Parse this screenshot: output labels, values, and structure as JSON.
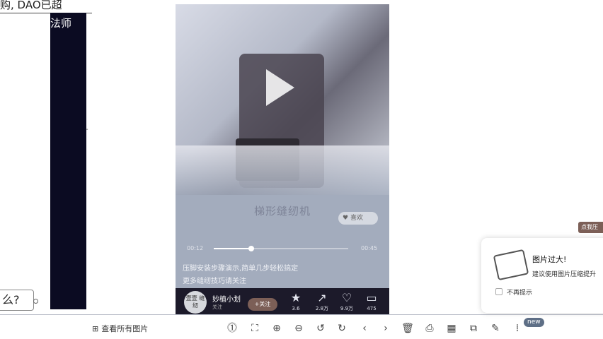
{
  "background_doc": {
    "top_text": "购, DAO已超",
    "panel_text": "法师",
    "left_bubble": "么?"
  },
  "photo": {
    "caption": "梯形缝纫机",
    "like_label": "喜欢",
    "progress_fraction": 0.28,
    "time_elapsed": "00:12",
    "time_total": "00:45",
    "description_line_1": "压脚安装步骤演示,简单几步轻松搞定",
    "description_line_2": "更多缝纫技巧请关注",
    "creator": {
      "avatar_text": "壹壹\n缝纫",
      "name": "妙植小划",
      "sub": "关注",
      "follow_label": "+关注"
    },
    "stats": [
      {
        "icon": "star-icon",
        "glyph": "★",
        "count": "3.6"
      },
      {
        "icon": "share-icon",
        "glyph": "↗",
        "count": "2.8万"
      },
      {
        "icon": "heart-icon",
        "glyph": "♡",
        "count": "9.9万"
      },
      {
        "icon": "comment-icon",
        "glyph": "▭",
        "count": "475"
      }
    ]
  },
  "toolbar": {
    "view_all_label": "查看所有图片",
    "new_badge": "new",
    "icons": [
      {
        "name": "one-to-one-icon",
        "glyph": "⓵"
      },
      {
        "name": "fit-icon",
        "glyph": "⛶"
      },
      {
        "name": "zoom-in-icon",
        "glyph": "⊕"
      },
      {
        "name": "zoom-out-icon",
        "glyph": "⊖"
      },
      {
        "name": "rotate-left-icon",
        "glyph": "↺"
      },
      {
        "name": "rotate-right-icon",
        "glyph": "↻"
      },
      {
        "name": "prev-icon",
        "glyph": "‹"
      },
      {
        "name": "next-icon",
        "glyph": "›"
      },
      {
        "name": "delete-icon",
        "glyph": "🗑"
      },
      {
        "name": "print-icon",
        "glyph": "⎙"
      },
      {
        "name": "gallery-icon",
        "glyph": "▦"
      },
      {
        "name": "copy-icon",
        "glyph": "⧉"
      },
      {
        "name": "edit-icon",
        "glyph": "✎"
      },
      {
        "name": "more-icon",
        "glyph": "⁞"
      }
    ]
  },
  "notification": {
    "title": "图片过大!",
    "body": "建议使用图片压缩提升",
    "checkbox_label": "不再提示",
    "corner_badge": "点我压"
  }
}
